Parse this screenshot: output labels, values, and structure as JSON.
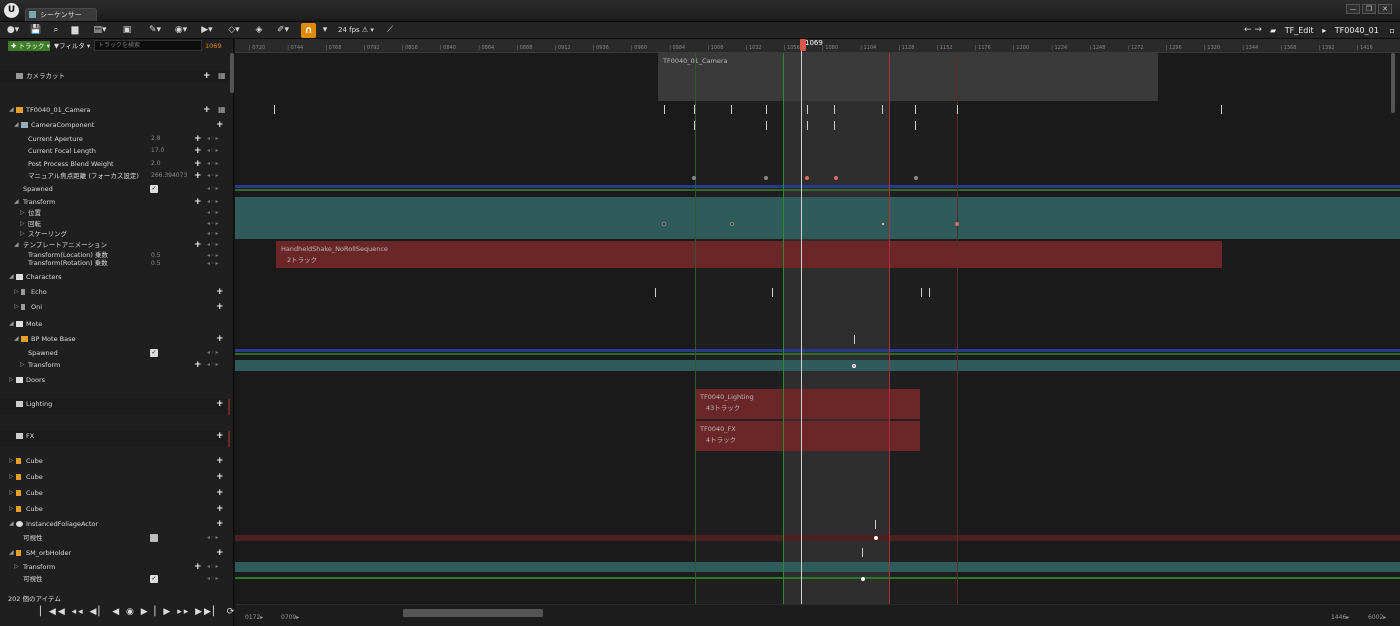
{
  "window": {
    "tab_title": "シーケンサー",
    "logo": "U",
    "minimize": "—",
    "maximize": "❐",
    "close": "✕"
  },
  "toolbar": {
    "fps": "24 fps",
    "breadcrumb_root": "TF_Edit",
    "breadcrumb_leaf": "TF0040_01",
    "icons": [
      "menu-icon",
      "save-icon",
      "search-icon",
      "camera-icon",
      "clapper-icon",
      "render-icon",
      "tools-icon",
      "eye-icon",
      "play-icon",
      "keyframe-icon",
      "curve-icon",
      "brush-icon",
      "snap-icon",
      "curve-editor-icon"
    ]
  },
  "left_panel": {
    "add_track": "✚ トラック ▾",
    "filter": "▼フィルタ ▾",
    "search_placeholder": "トラックを検索",
    "current_frame": "1069",
    "camera_cut": "カメラカット",
    "camera": "TF0040_01_Camera",
    "camera_component": "CameraComponent",
    "current_aperture": {
      "label": "Current Aperture",
      "value": "2.8"
    },
    "current_focal_length": {
      "label": "Current Focal Length",
      "value": "17.0"
    },
    "post_process": {
      "label": "Post Process Blend Weight",
      "value": "2.0"
    },
    "manual_focus": {
      "label": "マニュアル焦点距離 (フォーカス設定)",
      "value": "266.394073"
    },
    "spawned": "Spawned",
    "transform": "Transform",
    "position": "位置",
    "rotation": "回転",
    "scaling": "スケーリング",
    "template_anim": "テンプレートアニメーション",
    "tl_location": {
      "label": "Transform(Location) 乗数",
      "value": "0.5"
    },
    "tl_rotation": {
      "label": "Transform(Rotation) 乗数",
      "value": "0.5"
    },
    "characters": "Characters",
    "echo": "Echo",
    "oni": "Oni",
    "mote": "Mote",
    "bp_mote_base": "BP Mote Base",
    "mote_spawned": "Spawned",
    "mote_transform": "Transform",
    "doors": "Doors",
    "lighting": "Lighting",
    "fx": "FX",
    "cube": "Cube",
    "foliage": "InstancedFoliageActor",
    "visibility": "可視性",
    "orb_holder": "SM_orbHolder",
    "orb_transform": "Transform",
    "orb_visibility": "可視性",
    "key_controls": "◂◦▸",
    "items_count": "202 個のアイテム"
  },
  "transport": {
    "buttons": "▏◀◀ ◂◂ ◀▏ ◀ ◉ ▶ ▏▶ ▸▸ ▶▶▏ ⟳"
  },
  "timeline": {
    "ruler_ticks": [
      "0720",
      "0744",
      "0768",
      "0792",
      "0816",
      "0840",
      "0864",
      "0888",
      "0912",
      "0936",
      "0960",
      "0984",
      "1008",
      "1032",
      "1056",
      "1080",
      "1104",
      "1128",
      "1152",
      "1176",
      "1200",
      "1224",
      "1248",
      "1272",
      "1296",
      "1320",
      "1344",
      "1368",
      "1392",
      "1416"
    ],
    "playhead": "1069",
    "camera_section": "TF0040_01_Camera",
    "shake_section": "HandheldShake_NoRollSequence",
    "shake_tracks": "2トラック",
    "lighting_section": "TF0040_Lighting",
    "lighting_tracks": "43トラック",
    "fx_section": "TF0040_FX",
    "fx_tracks": "4トラック",
    "frame_start": "0172▸",
    "frame_in": "0709▸",
    "frame_out": "1446▸",
    "frame_end": "6002▸"
  },
  "colors": {
    "accent": "#e08a00",
    "add_green": "#3e7c27",
    "section_red": "#7a2a2c",
    "transform_teal": "#2f5b5a",
    "playhead": "#d8594a"
  }
}
